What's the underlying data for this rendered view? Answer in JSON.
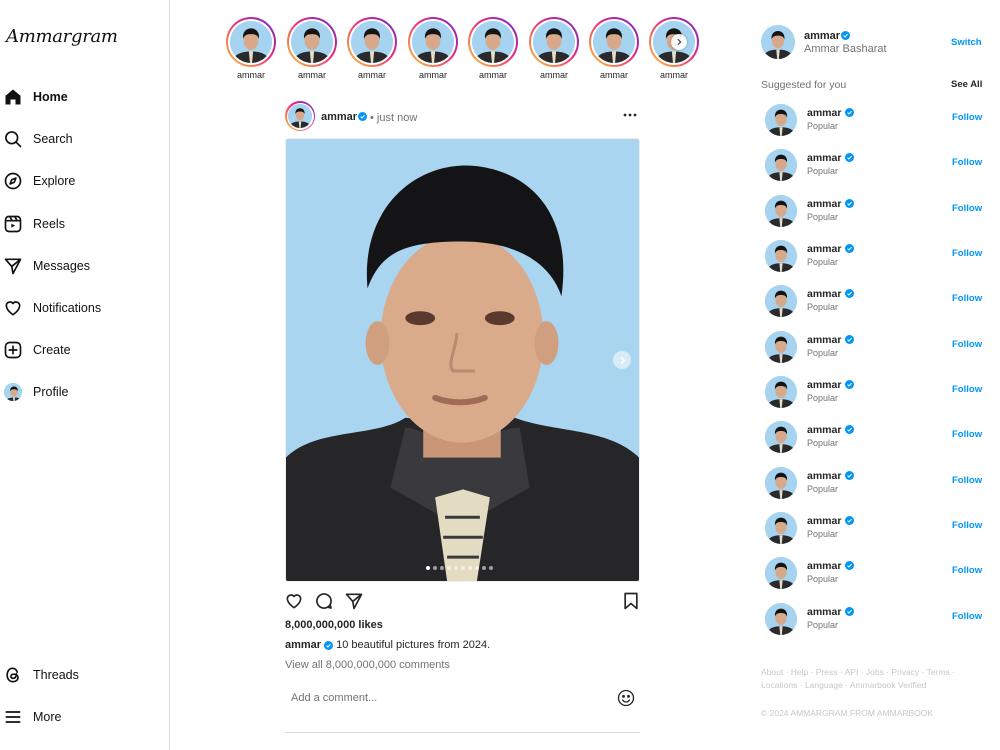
{
  "app": {
    "logo": "Ammargram"
  },
  "sidebar": {
    "items": [
      {
        "label": "Home",
        "icon": "home-icon",
        "active": true
      },
      {
        "label": "Search",
        "icon": "search-icon"
      },
      {
        "label": "Explore",
        "icon": "compass-icon"
      },
      {
        "label": "Reels",
        "icon": "reels-icon"
      },
      {
        "label": "Messages",
        "icon": "send-icon"
      },
      {
        "label": "Notifications",
        "icon": "heart-icon"
      },
      {
        "label": "Create",
        "icon": "plus-square-icon"
      },
      {
        "label": "Profile",
        "icon": "avatar"
      }
    ],
    "bottom": [
      {
        "label": "Threads",
        "icon": "threads-icon"
      },
      {
        "label": "More",
        "icon": "hamburger-icon"
      }
    ]
  },
  "stories": [
    {
      "username": "ammar"
    },
    {
      "username": "ammar"
    },
    {
      "username": "ammar"
    },
    {
      "username": "ammar"
    },
    {
      "username": "ammar"
    },
    {
      "username": "ammar"
    },
    {
      "username": "ammar"
    },
    {
      "username": "ammar"
    }
  ],
  "post": {
    "username": "ammar",
    "separator": "•",
    "time": "just now",
    "carousel_position": 1,
    "carousel_total": 10,
    "likes": "8,000,000,000 likes",
    "caption_user": "ammar",
    "caption_text": "10 beautiful pictures from 2024.",
    "view_comments": "View all 8,000,000,000 comments",
    "comment_placeholder": "Add a comment..."
  },
  "right": {
    "me": {
      "username": "ammar",
      "full_name": "Ammar Basharat",
      "switch_label": "Switch"
    },
    "suggested_title": "Suggested for you",
    "see_all": "See All",
    "suggestions": [
      {
        "username": "ammar",
        "subtitle": "Popular",
        "action": "Follow"
      },
      {
        "username": "ammar",
        "subtitle": "Popular",
        "action": "Follow"
      },
      {
        "username": "ammar",
        "subtitle": "Popular",
        "action": "Follow"
      },
      {
        "username": "ammar",
        "subtitle": "Popular",
        "action": "Follow"
      },
      {
        "username": "ammar",
        "subtitle": "Popular",
        "action": "Follow"
      },
      {
        "username": "ammar",
        "subtitle": "Popular",
        "action": "Follow"
      },
      {
        "username": "ammar",
        "subtitle": "Popular",
        "action": "Follow"
      },
      {
        "username": "ammar",
        "subtitle": "Popular",
        "action": "Follow"
      },
      {
        "username": "ammar",
        "subtitle": "Popular",
        "action": "Follow"
      },
      {
        "username": "ammar",
        "subtitle": "Popular",
        "action": "Follow"
      },
      {
        "username": "ammar",
        "subtitle": "Popular",
        "action": "Follow"
      },
      {
        "username": "ammar",
        "subtitle": "Popular",
        "action": "Follow"
      }
    ],
    "footer_links": "About · Help · Press · API · Jobs · Privacy · Terms · Locations · Language · Ammarbook Verified",
    "copyright": "© 2024 AMMARGRAM FROM AMMARBOOK"
  },
  "colors": {
    "link": "#0095f6",
    "verified": "#0095f6",
    "muted": "#737373",
    "photo_bg": "#a9d5f0"
  }
}
